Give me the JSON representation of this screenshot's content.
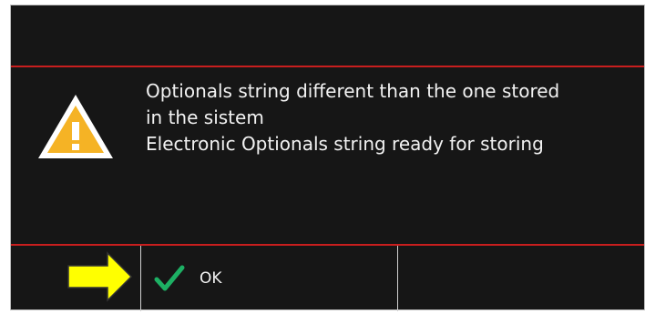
{
  "dialog": {
    "message_lines": [
      "Optionals string different than the one stored",
      "in the sistem",
      "Electronic Optionals string ready for storing"
    ],
    "icon": "warning-triangle-icon",
    "ok_button": {
      "label": "OK",
      "icon": "checkmark-icon"
    },
    "colors": {
      "background": "#161616",
      "separator": "#c81e1e",
      "warning": "#f5b325",
      "check": "#1db064",
      "annotation_arrow": "#ffff00"
    }
  },
  "annotation": {
    "icon": "yellow-arrow-right-icon"
  }
}
